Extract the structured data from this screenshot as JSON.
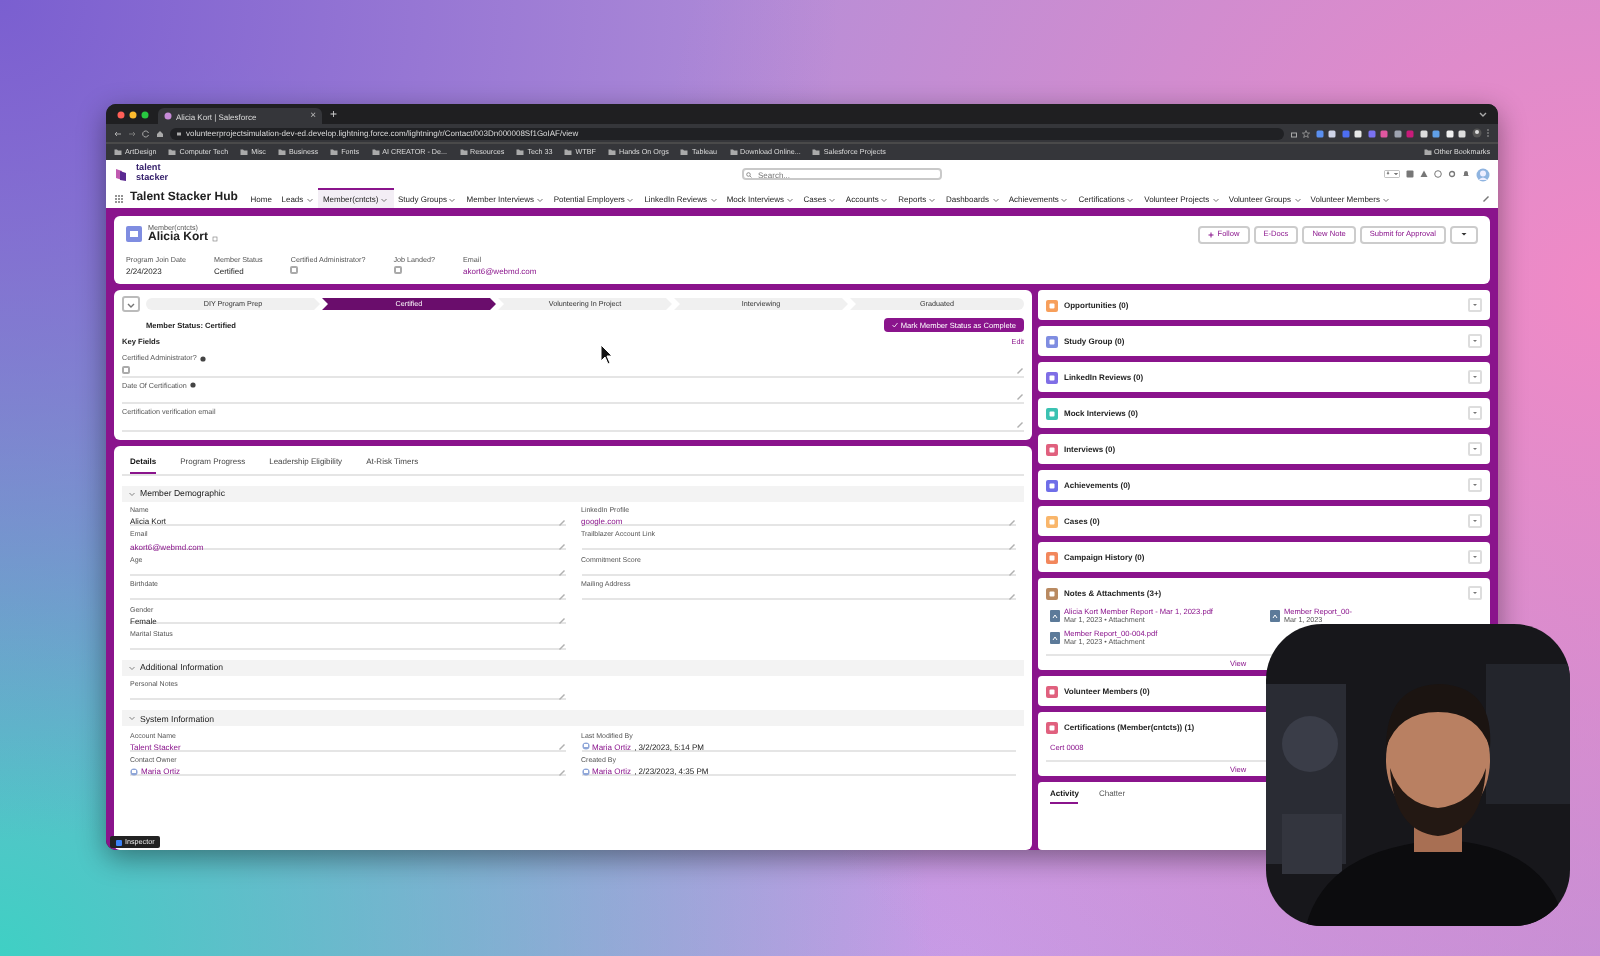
{
  "browser": {
    "tab_title": "Alicia Kort | Salesforce",
    "tab_close": "×",
    "new_tab": "+",
    "url": "volunteerprojectsimulation-dev-ed.develop.lightning.force.com/lightning/r/Contact/003Dn000008Sf1GoIAF/view",
    "bookmarks": [
      "ArtDesign",
      "Computer Tech",
      "Misc",
      "Business",
      "Fonts",
      "AI CREATOR - De...",
      "Resources",
      "Tech 33",
      "WTBF",
      "Hands On Orgs",
      "Tableau",
      "Download Online...",
      "Salesforce Projects"
    ],
    "other_bookmarks": "Other Bookmarks"
  },
  "app": {
    "logo": "talent stacker",
    "search": {
      "placeholder": "Search..."
    },
    "app_name": "Talent Stacker Hub",
    "nav": [
      {
        "label": "Home",
        "menu": false,
        "selected": false
      },
      {
        "label": "Leads",
        "menu": true,
        "selected": false
      },
      {
        "label": "Member(cntcts)",
        "menu": true,
        "selected": true
      },
      {
        "label": "Study Groups",
        "menu": true,
        "selected": false
      },
      {
        "label": "Member Interviews",
        "menu": true,
        "selected": false
      },
      {
        "label": "Potential Employers",
        "menu": true,
        "selected": false
      },
      {
        "label": "LinkedIn Reviews",
        "menu": true,
        "selected": false
      },
      {
        "label": "Mock Interviews",
        "menu": true,
        "selected": false
      },
      {
        "label": "Cases",
        "menu": true,
        "selected": false
      },
      {
        "label": "Accounts",
        "menu": true,
        "selected": false
      },
      {
        "label": "Reports",
        "menu": true,
        "selected": false
      },
      {
        "label": "Dashboards",
        "menu": true,
        "selected": false
      },
      {
        "label": "Achievements",
        "menu": true,
        "selected": false
      },
      {
        "label": "Certifications",
        "menu": true,
        "selected": false
      },
      {
        "label": "Volunteer Projects",
        "menu": true,
        "selected": false
      },
      {
        "label": "Volunteer Groups",
        "menu": true,
        "selected": false
      },
      {
        "label": "Volunteer Members",
        "menu": true,
        "selected": false
      }
    ]
  },
  "record": {
    "type": "Member(cntcts)",
    "name": "Alicia Kort",
    "buttons": [
      "Follow",
      "E-Docs",
      "New Note",
      "Submit for Approval"
    ],
    "fields": [
      {
        "kind": "text",
        "label": "Program Join Date",
        "value": "2/24/2023"
      },
      {
        "kind": "text",
        "label": "Member Status",
        "value": "Certified"
      },
      {
        "kind": "checkbox",
        "label": "Certified Administrator?",
        "checked": false
      },
      {
        "kind": "checkbox",
        "label": "Job Landed?",
        "checked": false
      },
      {
        "kind": "link",
        "label": "Email",
        "value": "akort6@webmd.com"
      }
    ]
  },
  "path": {
    "stages": [
      {
        "label": "DIY Program Prep",
        "selected": false
      },
      {
        "label": "Certified",
        "selected": true
      },
      {
        "label": "Volunteering In Project",
        "selected": false
      },
      {
        "label": "Interviewing",
        "selected": false
      },
      {
        "label": "Graduated",
        "selected": false
      }
    ],
    "status": "Member Status: Certified",
    "complete_button": "Mark Member Status as Complete",
    "key_fields_title": "Key Fields",
    "edit": "Edit",
    "key_fields": [
      {
        "kind": "checkbox",
        "label": "Certified Administrator?",
        "info": true,
        "checked": false
      },
      {
        "kind": "text",
        "label": "Date Of Certification",
        "info": true
      },
      {
        "kind": "text",
        "label": "Certification verification email",
        "info": false
      }
    ]
  },
  "details": {
    "tabs": [
      {
        "label": "Details",
        "selected": true
      },
      {
        "label": "Program Progress",
        "selected": false
      },
      {
        "label": "Leadership Eligibility",
        "selected": false
      },
      {
        "label": "At-Risk Timers",
        "selected": false
      }
    ],
    "sections": [
      {
        "title": "Member Demographic",
        "expanded": true,
        "left": [
          {
            "kind": "text",
            "label": "Name",
            "value": "Alicia Kort"
          },
          {
            "kind": "link",
            "label": "Email",
            "value": "akort6@webmd.com"
          },
          {
            "kind": "text",
            "label": "Age"
          },
          {
            "kind": "text",
            "label": "Birthdate"
          },
          {
            "kind": "text",
            "label": "Gender",
            "value": "Female"
          },
          {
            "kind": "text",
            "label": "Marital Status"
          }
        ],
        "right": [
          {
            "kind": "link",
            "label": "LinkedIn Profile",
            "value": "google.com"
          },
          {
            "kind": "text",
            "label": "Trailblazer Account Link"
          },
          {
            "kind": "text",
            "label": "Commitment Score"
          },
          {
            "kind": "text",
            "label": "Mailing Address"
          }
        ]
      },
      {
        "title": "Additional Information",
        "expanded": true,
        "left": [
          {
            "kind": "text",
            "label": "Personal Notes"
          }
        ]
      },
      {
        "title": "System Information",
        "expanded": true,
        "left": [
          {
            "kind": "link",
            "label": "Account Name",
            "value": "Talent Stacker"
          },
          {
            "kind": "user",
            "label": "Contact Owner",
            "value": "Maria Ortiz"
          }
        ],
        "right": [
          {
            "kind": "user",
            "label": "Last Modified By",
            "value": "Maria Ortiz",
            "date": ", 3/2/2023, 5:14 PM"
          },
          {
            "kind": "user",
            "label": "Created By",
            "value": "Maria Ortiz",
            "date": ", 2/23/2023, 4:35 PM"
          }
        ]
      }
    ]
  },
  "related": [
    {
      "kind": "list",
      "title": "Opportunities (0)",
      "color": "#f79f5b"
    },
    {
      "kind": "list",
      "title": "Study Group (0)",
      "color": "#7f8de1"
    },
    {
      "kind": "list",
      "title": "LinkedIn Reviews (0)",
      "color": "#7f6ee6"
    },
    {
      "kind": "list",
      "title": "Mock Interviews (0)",
      "color": "#3bc2b2"
    },
    {
      "kind": "list",
      "title": "Interviews (0)",
      "color": "#e0607e"
    },
    {
      "kind": "list",
      "title": "Achievements (0)",
      "color": "#6f6ee8"
    },
    {
      "kind": "list",
      "title": "Cases (0)",
      "color": "#f9b66b"
    },
    {
      "kind": "list",
      "title": "Campaign History (0)",
      "color": "#f2875c"
    },
    {
      "kind": "files",
      "title": "Notes & Attachments (3+)",
      "color": "#b98a61",
      "files": [
        {
          "name": "Alicia Kort Member Report - Mar 1, 2023.pdf",
          "meta": "Mar 1, 2023 • Attachment"
        },
        {
          "name": "Member Report_00-",
          "meta": "Mar 1, 2023"
        },
        {
          "name": "Member Report_00-004.pdf",
          "meta": "Mar 1, 2023 • Attachment"
        }
      ],
      "footer": "View"
    },
    {
      "kind": "list",
      "title": "Volunteer Members (0)",
      "color": "#e0607e",
      "menu": false
    },
    {
      "kind": "items",
      "title": "Certifications (Member(cntcts)) (1)",
      "color": "#e0607e",
      "menu": false,
      "items": [
        "Cert 0008"
      ],
      "footer": "View"
    }
  ],
  "activity_tabs": [
    {
      "label": "Activity",
      "selected": true
    },
    {
      "label": "Chatter",
      "selected": false
    }
  ],
  "inspector_badge": "Inspector"
}
